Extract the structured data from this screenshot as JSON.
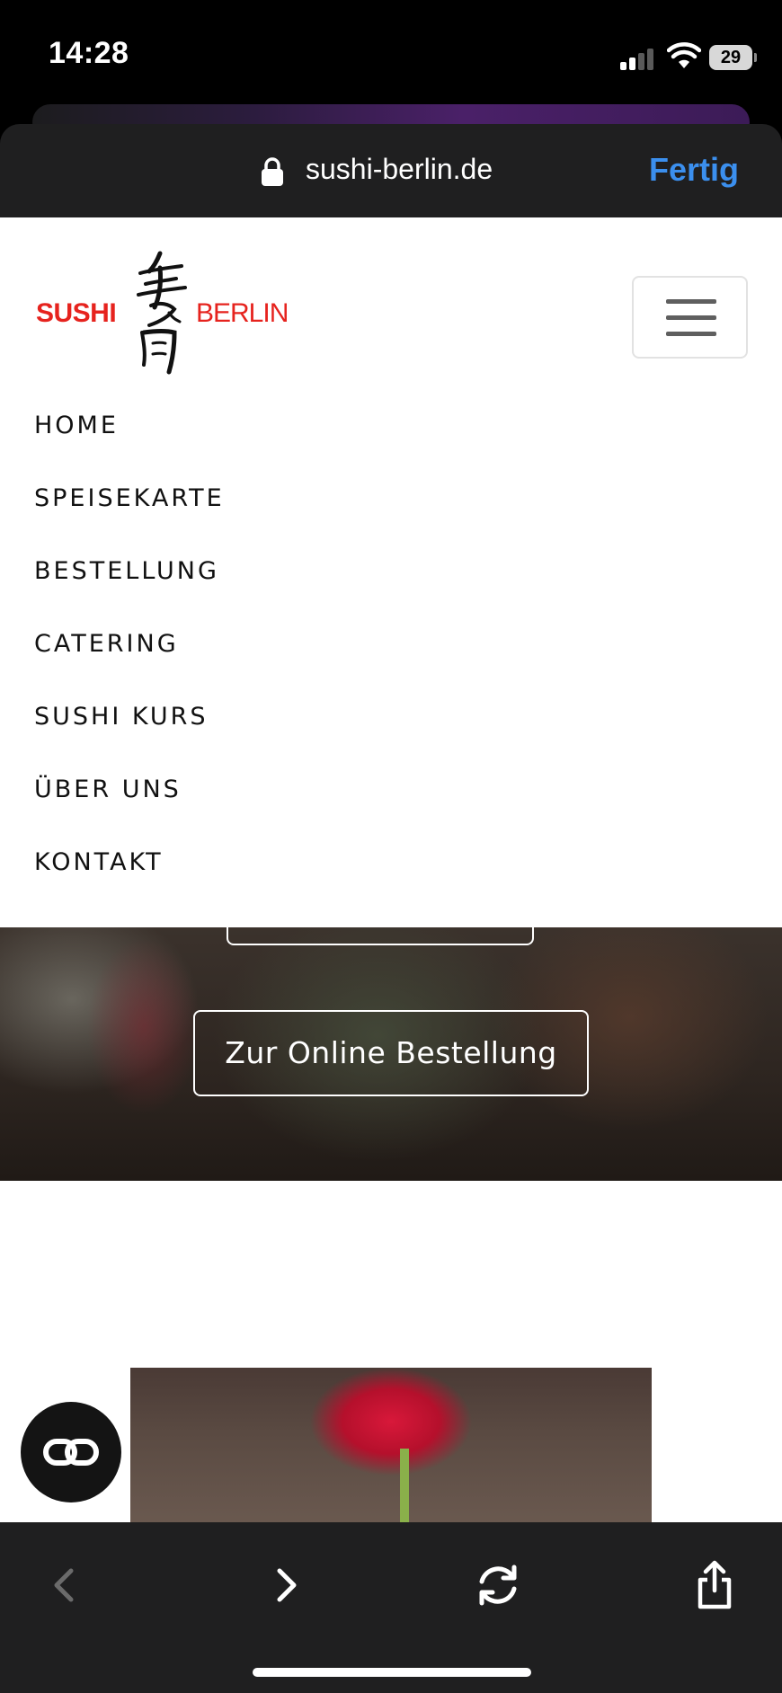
{
  "status_bar": {
    "time": "14:28",
    "battery": "29"
  },
  "browser": {
    "url": "sushi-berlin.de",
    "done_label": "Fertig"
  },
  "site": {
    "logo": {
      "left_text": "SUSHI",
      "right_text": "BERLIN",
      "kanji": "寿司"
    },
    "nav": [
      "HOME",
      "SPEISEKARTE",
      "BESTELLUNG",
      "CATERING",
      "SUSHI KURS",
      "ÜBER UNS",
      "KONTAKT"
    ],
    "hero_button": "Zur Online Bestellung"
  },
  "toolbar": {
    "icons": [
      "chevron-left-icon",
      "chevron-right-icon",
      "reload-icon",
      "share-icon"
    ]
  },
  "colors": {
    "brand_red": "#e6231e",
    "accent_blue": "#3b8fee",
    "toolbar_bg": "#1f1f20"
  }
}
